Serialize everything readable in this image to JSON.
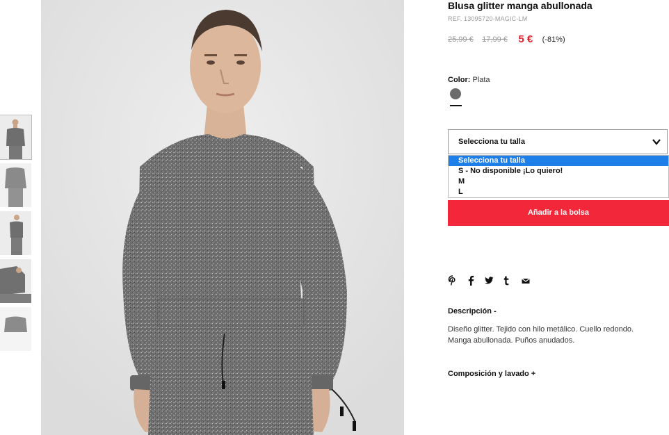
{
  "product": {
    "title": "Blusa glitter manga abullonada",
    "ref": "REF. 13095720-MAGIC-LM",
    "price_original": "25,99 €",
    "price_previous": "17,99 €",
    "price_current": "5 €",
    "discount": "(-81%)",
    "color_label": "Color:",
    "color_value": "Plata",
    "swatch_color": "#6b6b6b"
  },
  "size_select": {
    "label": "Selecciona tu talla",
    "options": [
      {
        "label": "Selecciona tu talla",
        "selected": true
      },
      {
        "label": "S - No disponible ¡Lo quiero!",
        "selected": false
      },
      {
        "label": "M",
        "selected": false
      },
      {
        "label": "L",
        "selected": false
      }
    ]
  },
  "actions": {
    "add_to_bag": "Añadir a la bolsa"
  },
  "share_icons": [
    "pinterest-icon",
    "facebook-icon",
    "twitter-icon",
    "tumblr-icon",
    "email-icon"
  ],
  "description": {
    "title": "Descripción -",
    "text": "Diseño glitter. Tejido con hilo metálico. Cuello redondo. Manga abullonada. Puños anudados."
  },
  "composition": {
    "title": "Composición y lavado +"
  },
  "colors": {
    "accent_red": "#f2273a",
    "price_red": "#e4202f",
    "selected_blue": "#1e7fe8"
  }
}
